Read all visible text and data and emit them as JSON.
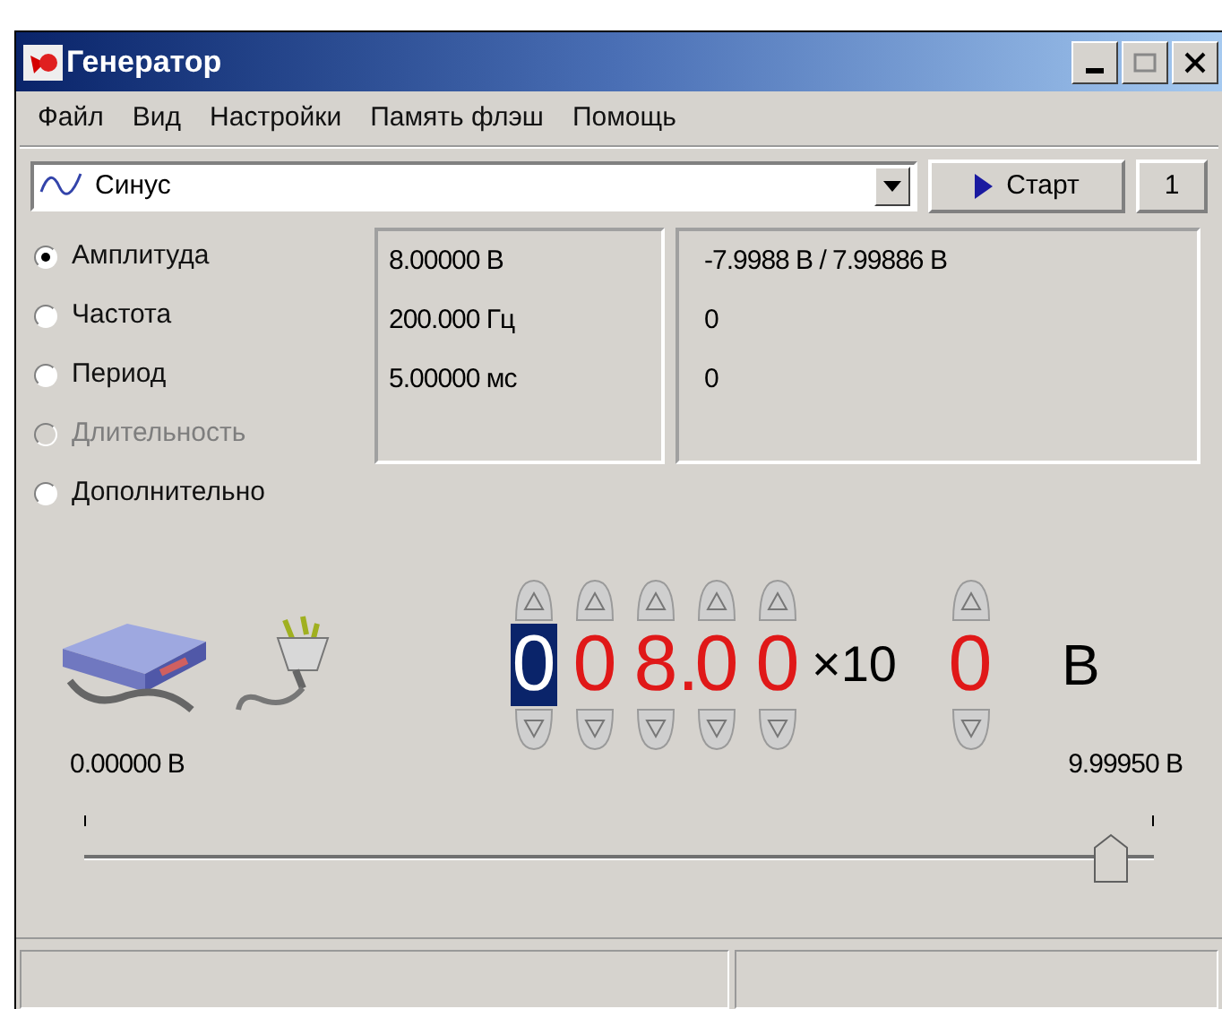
{
  "window": {
    "title": "Генератор"
  },
  "menu": [
    "Файл",
    "Вид",
    "Настройки",
    "Память флэш",
    "Помощь"
  ],
  "waveform": {
    "value": "Синус"
  },
  "start_button": "Старт",
  "channel_button": "1",
  "params": [
    {
      "label": "Амплитуда",
      "selected": true,
      "disabled": false,
      "value": "8.00000 В",
      "reading": "-7.9988 В / 7.99886 В"
    },
    {
      "label": "Частота",
      "selected": false,
      "disabled": false,
      "value": "200.000 Гц",
      "reading": "0"
    },
    {
      "label": "Период",
      "selected": false,
      "disabled": false,
      "value": "5.00000 мс",
      "reading": "0"
    },
    {
      "label": "Длительность",
      "selected": false,
      "disabled": true
    },
    {
      "label": "Дополнительно",
      "selected": false,
      "disabled": false
    }
  ],
  "display": {
    "digits": [
      {
        "kind": "digit",
        "text": "0",
        "selected": true
      },
      {
        "kind": "digit",
        "text": "0",
        "selected": false
      },
      {
        "kind": "digit",
        "text": "8",
        "selected": false
      },
      {
        "kind": "point",
        "text": "."
      },
      {
        "kind": "digit",
        "text": "0",
        "selected": false
      },
      {
        "kind": "digit",
        "text": "0",
        "selected": false
      }
    ],
    "multiplier": "×10",
    "exponent": {
      "text": "0",
      "selected": false
    },
    "unit": "В"
  },
  "slider": {
    "min_label": "0.00000 В",
    "max_label": "9.99950 В",
    "level": 0.96
  }
}
